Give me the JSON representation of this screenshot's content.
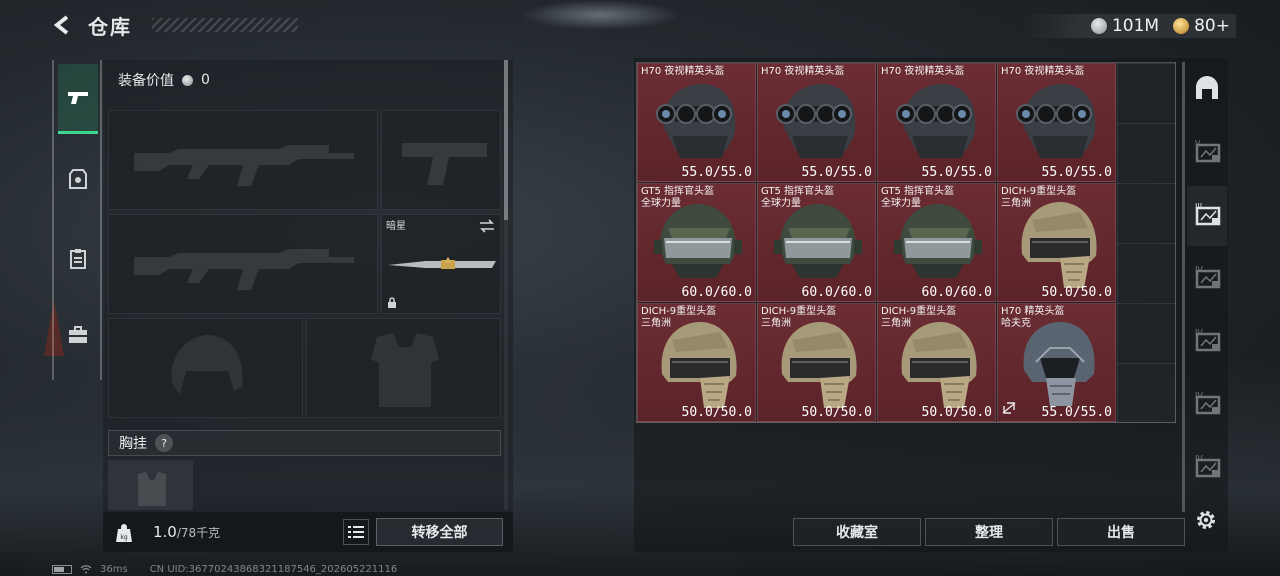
{
  "header": {
    "title": "仓库"
  },
  "currency": [
    {
      "name": "silver-coin",
      "value": "101M",
      "color": "#cfd3d6"
    },
    {
      "name": "gold-coin",
      "value": "80+",
      "color": "#d9a43b"
    }
  ],
  "categories": [
    {
      "name": "weapon-icon",
      "active": true
    },
    {
      "name": "armor-icon",
      "active": false
    },
    {
      "name": "clipboard-icon",
      "active": false
    },
    {
      "name": "briefcase-icon",
      "active": false
    }
  ],
  "loadout": {
    "equip_value_label": "装备价值",
    "equip_value": "0",
    "melee_label": "暗星",
    "chest_label": "胸挂",
    "help": "?",
    "capacity": "1.0",
    "capacity_max": "/78千克",
    "transfer_all": "转移全部"
  },
  "storage": {
    "items": [
      {
        "name": "H70 夜视精英头盔",
        "sub": "",
        "durability": "55.0/55.0",
        "type": "nv"
      },
      {
        "name": "H70 夜视精英头盔",
        "sub": "",
        "durability": "55.0/55.0",
        "type": "nv"
      },
      {
        "name": "H70 夜视精英头盔",
        "sub": "",
        "durability": "55.0/55.0",
        "type": "nv"
      },
      {
        "name": "H70 夜视精英头盔",
        "sub": "",
        "durability": "55.0/55.0",
        "type": "nv"
      },
      {
        "name": "GT5 指挥官头盔",
        "sub": "全球力量",
        "durability": "60.0/60.0",
        "type": "gt5"
      },
      {
        "name": "GT5 指挥官头盔",
        "sub": "全球力量",
        "durability": "60.0/60.0",
        "type": "gt5"
      },
      {
        "name": "GT5 指挥官头盔",
        "sub": "全球力量",
        "durability": "60.0/60.0",
        "type": "gt5"
      },
      {
        "name": "DICH-9重型头盔",
        "sub": "三角洲",
        "durability": "50.0/50.0",
        "type": "dich"
      },
      {
        "name": "DICH-9重型头盔",
        "sub": "三角洲",
        "durability": "50.0/50.0",
        "type": "dich"
      },
      {
        "name": "DICH-9重型头盔",
        "sub": "三角洲",
        "durability": "50.0/50.0",
        "type": "dich"
      },
      {
        "name": "DICH-9重型头盔",
        "sub": "三角洲",
        "durability": "50.0/50.0",
        "type": "dich"
      },
      {
        "name": "H70 精英头盔",
        "sub": "哈夫克",
        "durability": "55.0/55.0",
        "type": "h70"
      }
    ],
    "item_color": "#6b2d33"
  },
  "side_tabs": [
    {
      "name": "storage-home-icon",
      "label": ""
    },
    {
      "name": "storage-tab-v-icon",
      "label": "V"
    },
    {
      "name": "storage-tab-active-icon",
      "label": "III"
    },
    {
      "name": "storage-tab-iv-1-icon",
      "label": "IV"
    },
    {
      "name": "storage-tab-iv-2-icon",
      "label": "IV"
    },
    {
      "name": "storage-tab-iv-3-icon",
      "label": "IV"
    },
    {
      "name": "storage-tab-iv-4-icon",
      "label": "IV"
    }
  ],
  "actions": {
    "collection": "收藏室",
    "organize": "整理",
    "sell": "出售"
  },
  "status": {
    "ping": "36ms",
    "uid": "CN UID:36770243868321187546_202605221116"
  }
}
